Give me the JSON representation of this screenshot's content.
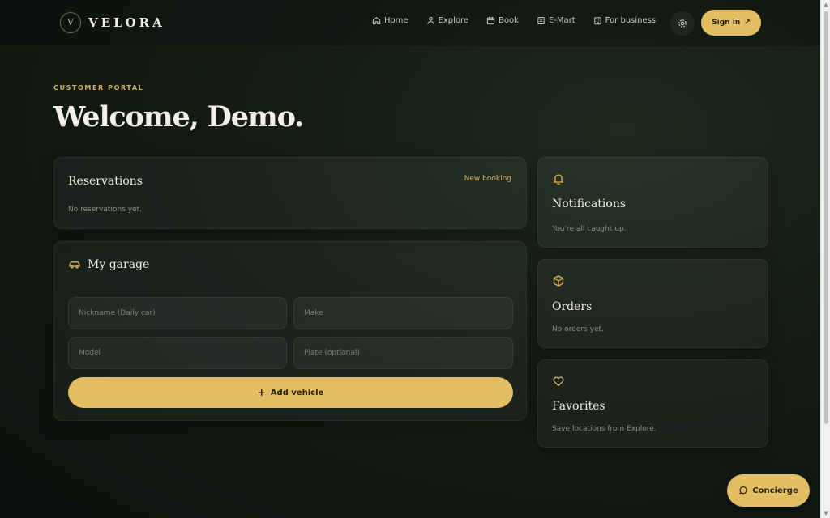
{
  "brand": {
    "mark": "V",
    "name": "VELORA"
  },
  "nav": [
    {
      "label": "Home",
      "icon": "home-icon"
    },
    {
      "label": "Explore",
      "icon": "user-icon"
    },
    {
      "label": "Book",
      "icon": "calendar-icon"
    },
    {
      "label": "E-Mart",
      "icon": "cart-icon"
    },
    {
      "label": "For business",
      "icon": "building-icon"
    }
  ],
  "header": {
    "settings_icon": "gear-icon",
    "signin_label": "Sign in",
    "signin_arrow": "↗"
  },
  "hero": {
    "eyebrow": "CUSTOMER PORTAL",
    "title": "Welcome, Demo."
  },
  "reservations": {
    "title": "Reservations",
    "link": "New booking",
    "empty": "No reservations yet."
  },
  "garage": {
    "title": "My garage",
    "icon": "car-icon",
    "fields": {
      "nickname_placeholder": "Nickname (Daily car)",
      "make_placeholder": "Make",
      "model_placeholder": "Model",
      "plate_placeholder": "Plate (optional)"
    },
    "add_label": "Add vehicle",
    "add_icon": "+"
  },
  "notifications": {
    "title": "Notifications",
    "text": "You're all caught up.",
    "icon": "bell-icon"
  },
  "orders": {
    "title": "Orders",
    "text": "No orders yet.",
    "icon": "box-icon"
  },
  "favorites": {
    "title": "Favorites",
    "text": "Save locations from Explore.",
    "icon": "heart-icon"
  },
  "concierge": {
    "label": "Concierge",
    "icon": "chat-icon"
  },
  "colors": {
    "accent": "#e3bd62",
    "eyebrow": "#d9b257",
    "background": "#131b14"
  }
}
